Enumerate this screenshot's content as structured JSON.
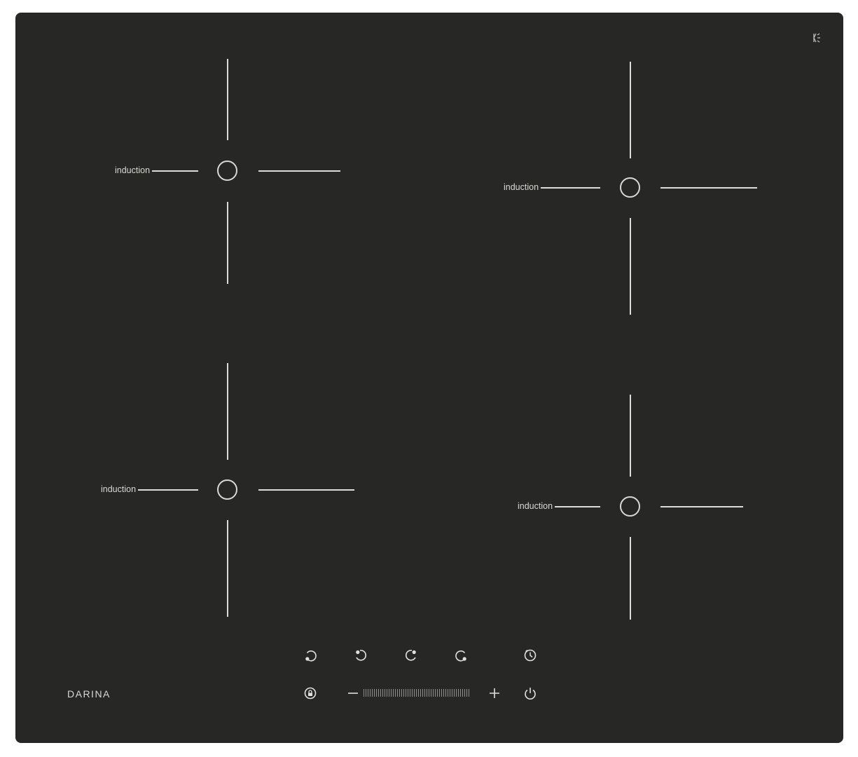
{
  "brand": "DARINA",
  "zones": [
    {
      "id": "top-left",
      "label": "induction"
    },
    {
      "id": "top-right",
      "label": "induction"
    },
    {
      "id": "bottom-left",
      "label": "induction"
    },
    {
      "id": "bottom-right",
      "label": "induction"
    }
  ],
  "controls": {
    "zone_selectors": [
      {
        "id": "rear-left",
        "icon": "zone-rear-left-icon"
      },
      {
        "id": "front-left",
        "icon": "zone-front-left-icon"
      },
      {
        "id": "front-right",
        "icon": "zone-front-right-icon"
      },
      {
        "id": "rear-right",
        "icon": "zone-rear-right-icon"
      }
    ],
    "timer_icon": "timer-icon",
    "lock_icon": "lock-icon",
    "power_icon": "power-icon",
    "slider_minus_icon": "minus-icon",
    "slider_plus_icon": "plus-icon"
  },
  "colors": {
    "glass": "#272825",
    "marking": "#d8d8d4"
  }
}
